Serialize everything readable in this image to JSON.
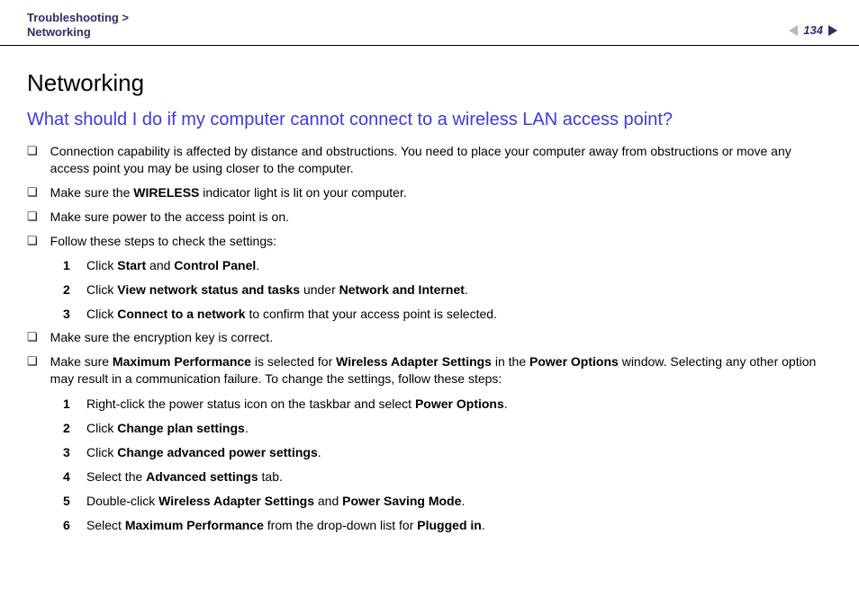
{
  "header": {
    "breadcrumb_top": "Troubleshooting >",
    "breadcrumb_bottom": "Networking",
    "page_number": "134"
  },
  "page_title": "Networking",
  "section_title": "What should I do if my computer cannot connect to a wireless LAN access point?",
  "bullets": {
    "b1": "Connection capability is affected by distance and obstructions. You need to place your computer away from obstructions or move any access point you may be using closer to the computer.",
    "b2_pre": "Make sure the ",
    "b2_bold": "WIRELESS",
    "b2_post": " indicator light is lit on your computer.",
    "b3": "Make sure power to the access point is on.",
    "b4": "Follow these steps to check the settings:",
    "b5": "Make sure the encryption key is correct.",
    "b6_parts": {
      "p1": "Make sure ",
      "b1": "Maximum Performance",
      "p2": " is selected for ",
      "b2": "Wireless Adapter Settings",
      "p3": " in the ",
      "b3": "Power Options",
      "p4": " window. Selecting any other option may result in a communication failure. To change the settings, follow these steps:"
    }
  },
  "steps1": {
    "s1": {
      "num": "1",
      "p1": "Click ",
      "b1": "Start",
      "p2": " and ",
      "b2": "Control Panel",
      "p3": "."
    },
    "s2": {
      "num": "2",
      "p1": "Click ",
      "b1": "View network status and tasks",
      "p2": " under ",
      "b2": "Network and Internet",
      "p3": "."
    },
    "s3": {
      "num": "3",
      "p1": "Click ",
      "b1": "Connect to a network",
      "p2": " to confirm that your access point is selected."
    }
  },
  "steps2": {
    "s1": {
      "num": "1",
      "p1": "Right-click the power status icon on the taskbar and select ",
      "b1": "Power Options",
      "p2": "."
    },
    "s2": {
      "num": "2",
      "p1": "Click ",
      "b1": "Change plan settings",
      "p2": "."
    },
    "s3": {
      "num": "3",
      "p1": "Click ",
      "b1": "Change advanced power settings",
      "p2": "."
    },
    "s4": {
      "num": "4",
      "p1": "Select the ",
      "b1": "Advanced settings",
      "p2": " tab."
    },
    "s5": {
      "num": "5",
      "p1": "Double-click ",
      "b1": "Wireless Adapter Settings",
      "p2": " and ",
      "b2": "Power Saving Mode",
      "p3": "."
    },
    "s6": {
      "num": "6",
      "p1": "Select ",
      "b1": "Maximum Performance",
      "p2": " from the drop-down list for ",
      "b2": "Plugged in",
      "p3": "."
    }
  }
}
